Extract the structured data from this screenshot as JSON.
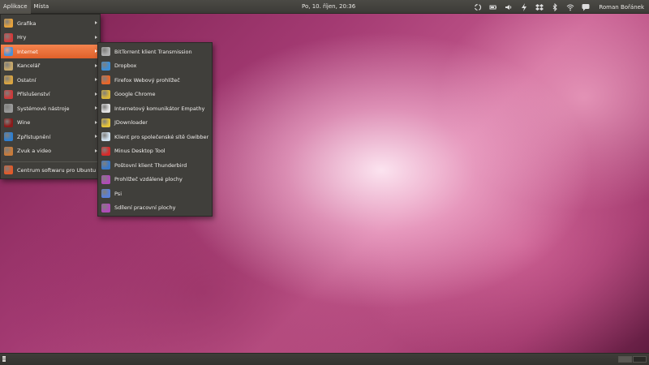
{
  "top_panel": {
    "menus": [
      "Aplikace",
      "Místa"
    ],
    "clock": "Po, 10. říjen, 20:36",
    "user": "Roman Bořánek",
    "tray_icons": [
      "sync-icon",
      "battery-icon",
      "volume-icon",
      "thunder-icon",
      "dropbox-icon",
      "bluetooth-icon",
      "wifi-icon",
      "chat-icon"
    ]
  },
  "app_menu": {
    "items": [
      {
        "label": "Grafika",
        "icon": "graphics-icon",
        "color": "#e6a23c"
      },
      {
        "label": "Hry",
        "icon": "games-icon",
        "color": "#d43a3a"
      },
      {
        "label": "Internet",
        "icon": "internet-icon",
        "color": "#4a90d9",
        "active": true
      },
      {
        "label": "Kancelář",
        "icon": "office-icon",
        "color": "#c7a86a"
      },
      {
        "label": "Ostatní",
        "icon": "other-icon",
        "color": "#d9a441"
      },
      {
        "label": "Příslušenství",
        "icon": "accessories-icon",
        "color": "#cc3b3b"
      },
      {
        "label": "Systémové nástroje",
        "icon": "system-tools-icon",
        "color": "#9a9a9a"
      },
      {
        "label": "Wine",
        "icon": "wine-icon",
        "color": "#8b1a1a"
      },
      {
        "label": "Zpřístupnění",
        "icon": "accessibility-icon",
        "color": "#2f7fd0"
      },
      {
        "label": "Zvuk a video",
        "icon": "sound-video-icon",
        "color": "#c97b3a"
      }
    ],
    "footer": {
      "label": "Centrum softwaru pro Ubuntu",
      "icon": "software-center-icon",
      "color": "#e05a2a"
    }
  },
  "internet_submenu": {
    "items": [
      {
        "label": "BitTorrent klient Transmission",
        "icon": "transmission-icon",
        "color": "#b0b0b0"
      },
      {
        "label": "Dropbox",
        "icon": "dropbox-app-icon",
        "color": "#3d8fd8"
      },
      {
        "label": "Firefox Webový prohlížeč",
        "icon": "firefox-icon",
        "color": "#e8662a"
      },
      {
        "label": "Google Chrome",
        "icon": "chrome-icon",
        "color": "#d9b63a"
      },
      {
        "label": "Internetový komunikátor Empathy",
        "icon": "empathy-icon",
        "color": "#e2e2e2"
      },
      {
        "label": "JDownloader",
        "icon": "jdownloader-icon",
        "color": "#e3c23a"
      },
      {
        "label": "Klient pro společenské sítě Gwibber",
        "icon": "gwibber-icon",
        "color": "#cfe0ee"
      },
      {
        "label": "Minus Desktop Tool",
        "icon": "minus-icon",
        "color": "#d72a2a"
      },
      {
        "label": "Poštovní klient Thunderbird",
        "icon": "thunderbird-icon",
        "color": "#3a79c9"
      },
      {
        "label": "Prohlížeč vzdálené plochy",
        "icon": "remote-viewer-icon",
        "color": "#b04bb8"
      },
      {
        "label": "Psi",
        "icon": "psi-icon",
        "color": "#5a7fd8"
      },
      {
        "label": "Sdílení pracovní plochy",
        "icon": "desktop-sharing-icon",
        "color": "#b04bb8"
      }
    ]
  }
}
